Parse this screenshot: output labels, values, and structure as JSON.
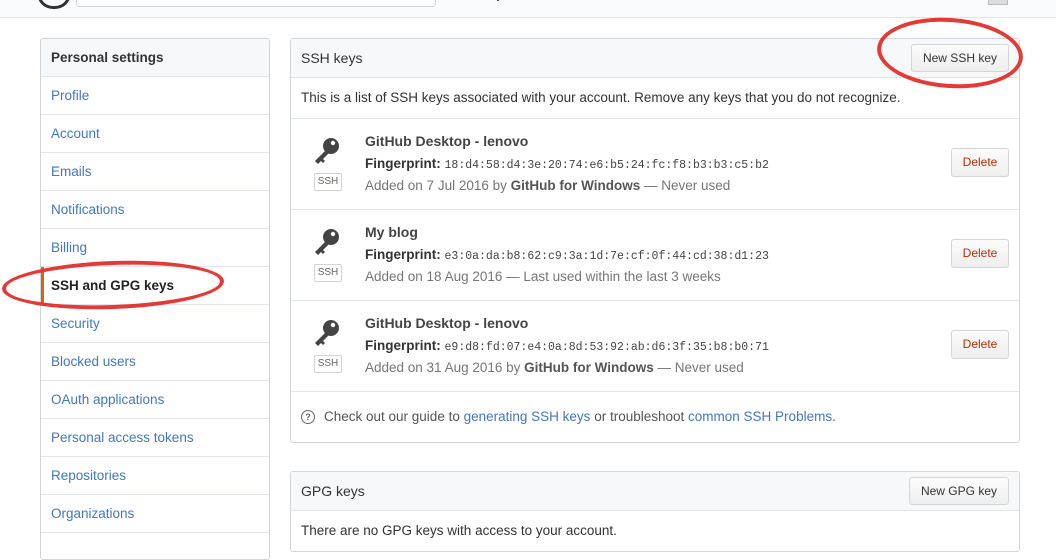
{
  "sidebar": {
    "heading": "Personal settings",
    "items": [
      {
        "label": "Profile"
      },
      {
        "label": "Account"
      },
      {
        "label": "Emails"
      },
      {
        "label": "Notifications"
      },
      {
        "label": "Billing"
      },
      {
        "label": "SSH and GPG keys"
      },
      {
        "label": "Security"
      },
      {
        "label": "Blocked users"
      },
      {
        "label": "OAuth applications"
      },
      {
        "label": "Personal access tokens"
      },
      {
        "label": "Repositories"
      },
      {
        "label": "Organizations"
      }
    ]
  },
  "ssh": {
    "title": "SSH keys",
    "new_button": "New SSH key",
    "intro": "This is a list of SSH keys associated with your account. Remove any keys that you do not recognize.",
    "keys": [
      {
        "name": "GitHub Desktop - lenovo",
        "badge": "SSH",
        "fingerprint_label": "Fingerprint:",
        "fingerprint": "18:d4:58:d4:3e:20:74:e6:b5:24:fc:f8:b3:b3:c5:b2",
        "added_prefix": "Added on 7 Jul 2016 by ",
        "added_by": "GitHub for Windows",
        "added_suffix": " — Never used",
        "delete": "Delete"
      },
      {
        "name": "My blog",
        "badge": "SSH",
        "fingerprint_label": "Fingerprint:",
        "fingerprint": "e3:0a:da:b8:62:c9:3a:1d:7e:cf:0f:44:cd:38:d1:23",
        "added_prefix": "Added on 18 Aug 2016 — Last used within the last 3 weeks",
        "added_by": "",
        "added_suffix": "",
        "delete": "Delete"
      },
      {
        "name": "GitHub Desktop - lenovo",
        "badge": "SSH",
        "fingerprint_label": "Fingerprint:",
        "fingerprint": "e9:d8:fd:07:e4:0a:8d:53:92:ab:d6:3f:35:b8:b0:71",
        "added_prefix": "Added on 31 Aug 2016 by ",
        "added_by": "GitHub for Windows",
        "added_suffix": " — Never used",
        "delete": "Delete"
      }
    ],
    "help": {
      "pre": "Check out our guide to ",
      "link1": "generating SSH keys",
      "mid": " or troubleshoot ",
      "link2": "common SSH Problems",
      "post": "."
    }
  },
  "gpg": {
    "title": "GPG keys",
    "new_button": "New GPG key",
    "empty_text": "There are no GPG keys with access to your account."
  },
  "annotation_color": "#e53935",
  "link_color": "#4078c0",
  "delete_color": "#bd2c00"
}
